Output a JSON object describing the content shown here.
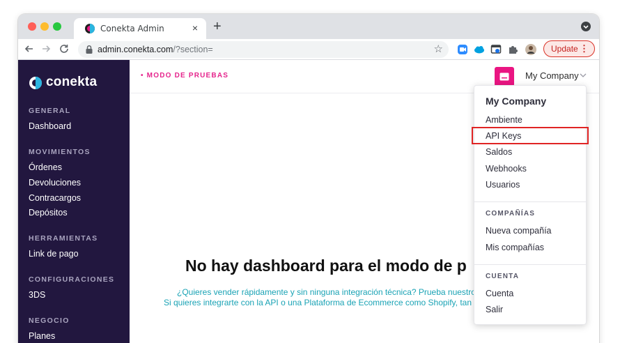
{
  "browser": {
    "tab_title": "Conekta Admin",
    "tab_close": "×",
    "new_tab": "+",
    "url_host": "admin.conekta.com",
    "url_path": "/?section=",
    "bookmark_star": "☆",
    "update_label": "Update",
    "update_menu": "⋮",
    "icons": [
      "back-icon",
      "forward-icon",
      "reload-icon",
      "lock-icon",
      "star-icon",
      "zoom-extension-icon",
      "cloud-extension-icon",
      "screen-extension-icon",
      "puzzle-extension-icon",
      "profile-avatar-icon"
    ]
  },
  "sidebar": {
    "logo_text": "conekta",
    "sections": [
      {
        "title": "GENERAL",
        "items": [
          "Dashboard"
        ]
      },
      {
        "title": "MOVIMIENTOS",
        "items": [
          "Órdenes",
          "Devoluciones",
          "Contracargos",
          "Depósitos"
        ]
      },
      {
        "title": "HERRAMIENTAS",
        "items": [
          "Link de pago"
        ]
      },
      {
        "title": "CONFIGURACIONES",
        "items": [
          "3DS"
        ]
      },
      {
        "title": "NEGOCIO",
        "items": [
          "Planes"
        ]
      }
    ]
  },
  "topbar": {
    "mode": "• MODO DE PRUEBAS",
    "company": "My Company"
  },
  "main": {
    "title": "No hay dashboard para el modo de p",
    "subtitle_line1": "¿Quieres vender rápidamente y sin ninguna integración técnica? Prueba nuestro",
    "subtitle_line2": "Si quieres integrarte con la API o una Plataforma de Ecommerce como Shopify, tan"
  },
  "dropdown": {
    "title": "My Company",
    "items": [
      "Ambiente",
      "API Keys",
      "Saldos",
      "Webhooks",
      "Usuarios"
    ],
    "companies_title": "COMPAÑÍAS",
    "companies_items": [
      "Nueva compañía",
      "Mis compañías"
    ],
    "account_title": "CUENTA",
    "account_items": [
      "Cuenta",
      "Salir"
    ],
    "highlighted_item": "API Keys"
  },
  "colors": {
    "sidebar_bg": "#22173f",
    "accent_pink": "#e5248c",
    "link_teal": "#1aa3b5",
    "highlight_red": "#e02424"
  }
}
